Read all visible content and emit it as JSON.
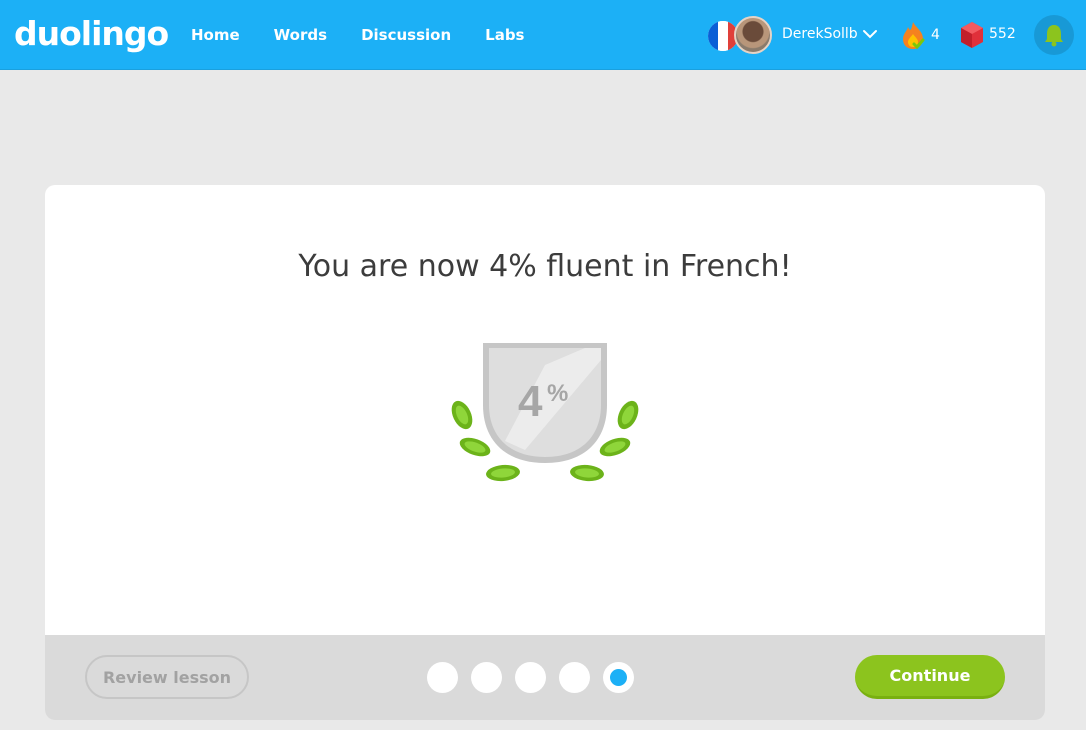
{
  "header": {
    "logo": "duolingo",
    "nav": [
      "Home",
      "Words",
      "Discussion",
      "Labs"
    ],
    "username": "DerekSollb",
    "streak": "4",
    "gems": "552",
    "language_flag": "french-flag-icon",
    "colors": {
      "bar": "#1cb0f6",
      "bell_bg": "#1899d6"
    }
  },
  "card": {
    "headline": "You are now 4% fluent in French!",
    "badge_value": "4",
    "badge_unit": "%",
    "review_label": "Review lesson",
    "continue_label": "Continue",
    "progress_dots_total": 5,
    "progress_dot_active": 5,
    "colors": {
      "continue": "#8cc41e",
      "active_dot": "#1cb0f6",
      "leaves": "#6cb31a"
    }
  }
}
